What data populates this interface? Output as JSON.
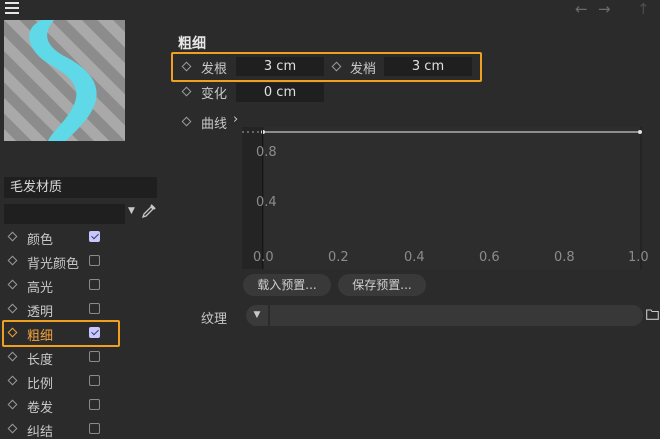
{
  "toolbar": {
    "menu_icon": "hamburger-menu-icon",
    "back_icon": "arrow-left-icon",
    "forward_icon": "arrow-right-icon",
    "up_icon": "arrow-up-icon"
  },
  "material": {
    "name": "毛发材质",
    "preview_icon": "hair-preview",
    "pipette_icon": "eyedropper-icon"
  },
  "channels": [
    {
      "label": "颜色",
      "checked": true,
      "active": false
    },
    {
      "label": "背光颜色",
      "checked": false,
      "active": false
    },
    {
      "label": "高光",
      "checked": false,
      "active": false
    },
    {
      "label": "透明",
      "checked": false,
      "active": false
    },
    {
      "label": "粗细",
      "checked": true,
      "active": true
    },
    {
      "label": "长度",
      "checked": false,
      "active": false
    },
    {
      "label": "比例",
      "checked": false,
      "active": false
    },
    {
      "label": "卷发",
      "checked": false,
      "active": false
    },
    {
      "label": "纠结",
      "checked": false,
      "active": false
    }
  ],
  "section": {
    "title": "粗细",
    "root_label": "发根",
    "root_value": "3 cm",
    "tip_label": "发梢",
    "tip_value": "3 cm",
    "variation_label": "变化",
    "variation_value": "0 cm",
    "curve_label": "曲线",
    "curve_expander": "›"
  },
  "curve": {
    "x_ticks": [
      "0.0",
      "0.2",
      "0.4",
      "0.6",
      "0.8",
      "1.0"
    ],
    "y_ticks": [
      "0.8",
      "0.4"
    ]
  },
  "buttons": {
    "load_preset": "载入预置...",
    "save_preset": "保存预置..."
  },
  "texture": {
    "label": "纹理",
    "folder_icon": "folder-icon"
  },
  "colors": {
    "accent": "#f0a020",
    "swatch_cyan": "#5fd8e8"
  }
}
